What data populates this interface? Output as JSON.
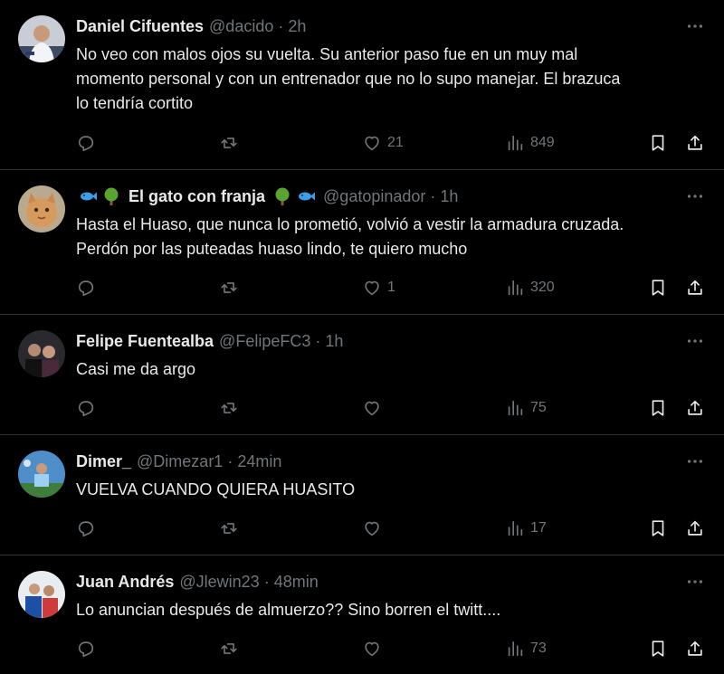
{
  "colors": {
    "background": "#000000",
    "text_primary": "#e7e9ea",
    "text_secondary": "#71767b",
    "divider": "#2f3336"
  },
  "tweets": [
    {
      "display_name": "Daniel Cifuentes",
      "handle": "@dacido",
      "separator": "·",
      "time": "2h",
      "text_lines": [
        "No veo con malos ojos su vuelta. Su anterior paso fue en un muy mal",
        "momento personal y con un entrenador que no lo supo manejar. El brazuca",
        "lo tendría cortito"
      ],
      "likes": "21",
      "views": "849"
    },
    {
      "display_name": "El gato con franja",
      "name_emojis": [
        "fish-icon",
        "tree-icon",
        "tree-icon",
        "fish-icon"
      ],
      "handle": "@gatopinador",
      "separator": "·",
      "time": "1h",
      "text_lines": [
        "Hasta el Huaso, que nunca lo prometió, volvió a vestir la armadura cruzada.",
        "Perdón por las puteadas huaso lindo, te quiero mucho"
      ],
      "likes": "1",
      "views": "320"
    },
    {
      "display_name": "Felipe Fuentealba",
      "handle": "@FelipeFC3",
      "separator": "·",
      "time": "1h",
      "text_lines": [
        "Casi me da argo"
      ],
      "likes": "",
      "views": "75"
    },
    {
      "display_name": "Dimer_",
      "handle": "@Dimezar1",
      "separator": "·",
      "time": "24min",
      "text_lines": [
        "VUELVA CUANDO QUIERA HUASITO"
      ],
      "likes": "",
      "views": "17"
    },
    {
      "display_name": "Juan Andrés",
      "handle": "@Jlewin23",
      "separator": "·",
      "time": "48min",
      "text_lines": [
        "Lo anuncian después de almuerzo?? Sino borren el twitt...."
      ],
      "likes": "",
      "views": "73"
    }
  ]
}
